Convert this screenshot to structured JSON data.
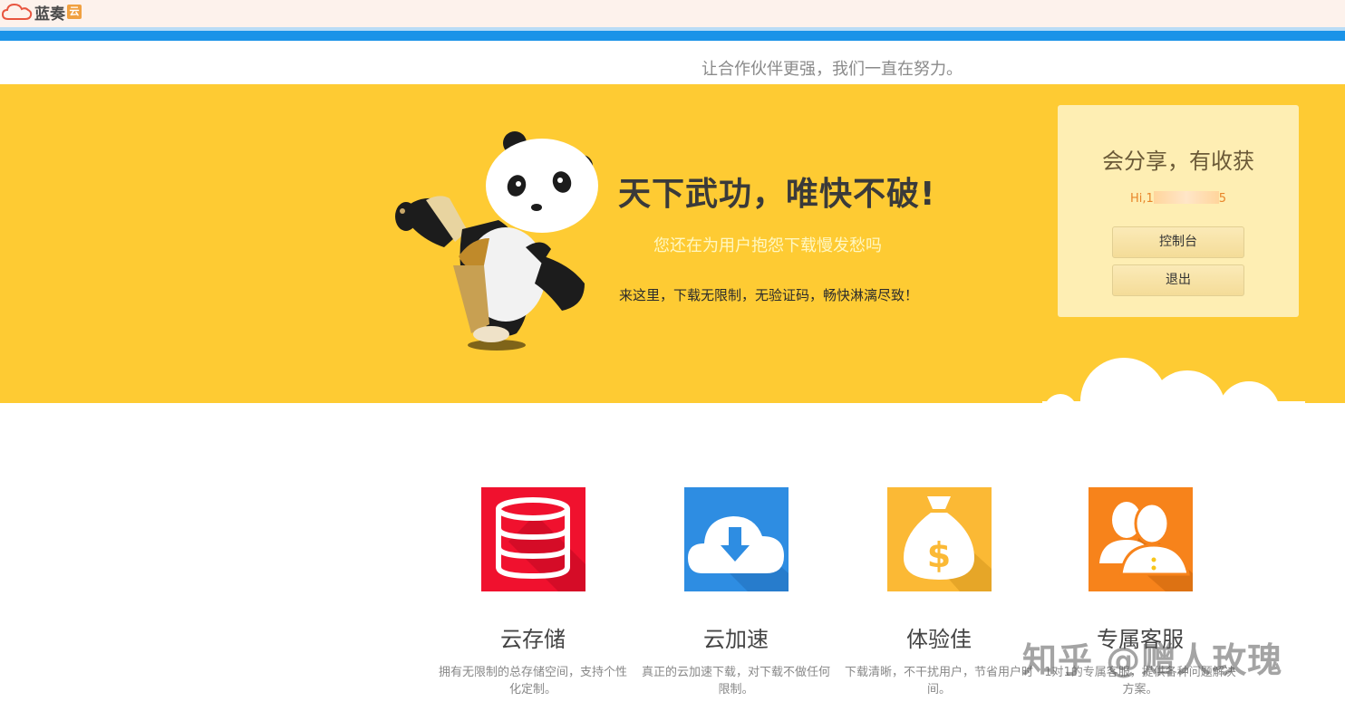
{
  "header": {
    "logo_text": "蓝奏",
    "logo_badge": "云",
    "slogan": "让合作伙伴更强，我们一直在努力。"
  },
  "hero": {
    "title": "天下武功，唯快不破!",
    "subtitle": "您还在为用户抱怨下载慢发愁吗",
    "description": "来这里，下载无限制，无验证码，畅快淋漓尽致！"
  },
  "user_panel": {
    "title": "会分享，有收获",
    "greeting": "Hi,1",
    "greeting_tail": "5",
    "console_button": "控制台",
    "logout_button": "退出"
  },
  "features": [
    {
      "name": "云存储",
      "desc": "拥有无限制的总存储空间，支持个性化定制。",
      "color": "#f0112e"
    },
    {
      "name": "云加速",
      "desc": "真正的云加速下载，对下载不做任何限制。",
      "color": "#2e8de2"
    },
    {
      "name": "体验佳",
      "desc": "下载清晰，不干扰用户，节省用户时间。",
      "color": "#fbb935"
    },
    {
      "name": "专属客服",
      "desc": "1对1的专属客服，提供各种问题解决方案。",
      "color": "#f7831b"
    }
  ],
  "watermark": "知乎 @赠人玫瑰",
  "colors": {
    "hero_bg": "#fecb33",
    "accent_blue": "#1a93e8",
    "panel_bg": "#feeeb3"
  }
}
